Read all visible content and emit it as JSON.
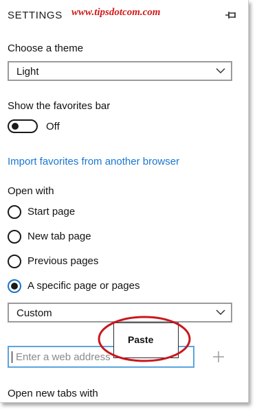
{
  "panel": {
    "title": "SETTINGS",
    "watermark": "www.tipsdotcom.com",
    "pin_icon": "pin-icon"
  },
  "theme": {
    "label": "Choose a theme",
    "selected": "Light"
  },
  "favorites_bar": {
    "label": "Show the favorites bar",
    "state": "Off"
  },
  "import_link": "Import favorites from another browser",
  "open_with": {
    "label": "Open with",
    "options": [
      {
        "label": "Start page",
        "checked": false
      },
      {
        "label": "New tab page",
        "checked": false
      },
      {
        "label": "Previous pages",
        "checked": false
      },
      {
        "label": "A specific page or pages",
        "checked": true
      }
    ],
    "page_select": "Custom",
    "address_placeholder": "Enter a web address",
    "add_icon": "plus-icon"
  },
  "context_menu": {
    "paste_label": "Paste",
    "highlight_color": "#c8161d"
  },
  "open_new_tabs": {
    "label": "Open new tabs with"
  },
  "colors": {
    "link": "#1976d2",
    "accent": "#5ba4de",
    "watermark": "#d11a1a"
  }
}
